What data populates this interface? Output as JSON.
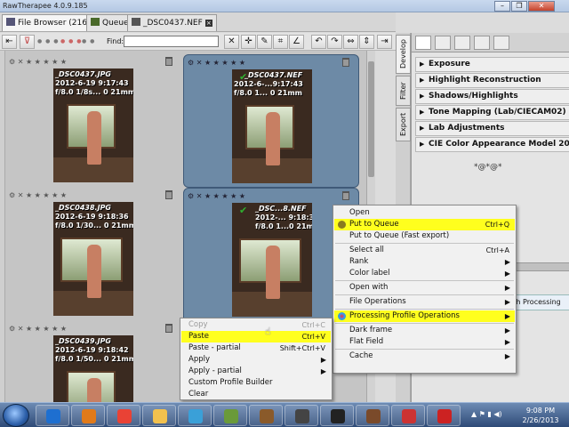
{
  "window": {
    "title": "RawTherapee 4.0.9.185",
    "controls": [
      "–",
      "❐",
      "✕"
    ]
  },
  "tabs": [
    {
      "label": "File Browser (216)",
      "active": true,
      "closable": false
    },
    {
      "label": "Queue",
      "active": false,
      "closable": false
    },
    {
      "label": "_DSC0437.NEF",
      "active": false,
      "closable": true
    }
  ],
  "toolbar": {
    "find_label": "Find:",
    "find_value": ""
  },
  "thumbnails": [
    {
      "filename": "_DSC0437.JPG",
      "date": "2012-6-19 9:17:43",
      "exposure": "f/8.0 1/8s... 0 21mm",
      "selected": false,
      "processed": false
    },
    {
      "filename": "_DSC0437.NEF",
      "date": "2012-6-...9:17:43",
      "exposure": "f/8.0 1... 0 21mm",
      "selected": true,
      "processed": true
    },
    {
      "filename": "_DSC0438.JPG",
      "date": "2012-6-19 9:18:36",
      "exposure": "f/8.0 1/30... 0 21mm",
      "selected": false,
      "processed": false
    },
    {
      "filename": "_DSC...8.NEF",
      "date": "2012-... 9:18:36",
      "exposure": "f/8.0 1...0 21mm",
      "selected": true,
      "processed": true
    },
    {
      "filename": "_DSC0439.JPG",
      "date": "2012-6-19 9:18:42",
      "exposure": "f/8.0 1/50... 0 21mm",
      "selected": false,
      "processed": false
    }
  ],
  "vertical_tabs": [
    "Develop",
    "Filter",
    "Export"
  ],
  "sections": [
    "Exposure",
    "Highlight Reconstruction",
    "Shadows/Highlights",
    "Tone Mapping (Lab/CIECAM02)",
    "Lab Adjustments",
    "CIE Color Appearance Model 2002"
  ],
  "ornament": "*@*@*",
  "batch_button": "ch Processing",
  "context_menu": [
    {
      "label": "Open",
      "accel": "",
      "sub": false,
      "highlight": false,
      "sep_after": false
    },
    {
      "label": "Put to Queue",
      "accel": "Ctrl+Q",
      "sub": false,
      "highlight": true,
      "icon": "gears-icon",
      "sep_after": false
    },
    {
      "label": "Put to Queue (Fast export)",
      "accel": "",
      "sub": false,
      "highlight": false,
      "sep_after": true
    },
    {
      "label": "Select all",
      "accel": "Ctrl+A",
      "sub": false,
      "highlight": false,
      "sep_after": false
    },
    {
      "label": "Rank",
      "accel": "",
      "sub": true,
      "highlight": false,
      "sep_after": false
    },
    {
      "label": "Color label",
      "accel": "",
      "sub": true,
      "highlight": false,
      "sep_after": true
    },
    {
      "label": "Open with",
      "accel": "",
      "sub": true,
      "highlight": false,
      "sep_after": true
    },
    {
      "label": "File Operations",
      "accel": "",
      "sub": true,
      "highlight": false,
      "sep_after": true
    },
    {
      "label": "Processing Profile Operations",
      "accel": "",
      "sub": true,
      "highlight": true,
      "icon": "profile-icon",
      "sep_after": true
    },
    {
      "label": "Dark frame",
      "accel": "",
      "sub": true,
      "highlight": false,
      "sep_after": false
    },
    {
      "label": "Flat Field",
      "accel": "",
      "sub": true,
      "highlight": false,
      "sep_after": true
    },
    {
      "label": "Cache",
      "accel": "",
      "sub": true,
      "highlight": false,
      "sep_after": false
    }
  ],
  "sub_menu": [
    {
      "label": "Copy",
      "accel": "Ctrl+C",
      "disabled": true,
      "highlight": false
    },
    {
      "label": "Paste",
      "accel": "Ctrl+V",
      "disabled": false,
      "highlight": true
    },
    {
      "label": "Paste - partial",
      "accel": "Shift+Ctrl+V",
      "disabled": false,
      "highlight": false
    },
    {
      "label": "Apply",
      "accel": "",
      "sub": true,
      "disabled": false,
      "highlight": false
    },
    {
      "label": "Apply - partial",
      "accel": "",
      "sub": true,
      "disabled": false,
      "highlight": false
    },
    {
      "label": "Custom Profile Builder",
      "accel": "",
      "disabled": false,
      "highlight": false
    },
    {
      "label": "Clear",
      "accel": "",
      "disabled": false,
      "highlight": false
    }
  ],
  "taskbar": {
    "clock_time": "9:08 PM",
    "clock_date": "2/26/2013",
    "apps": [
      "internet-explorer",
      "firefox",
      "chrome",
      "file-explorer",
      "photo-viewer",
      "image-editor",
      "book-app",
      "terminal",
      "game-app",
      "library-app",
      "color-app",
      "rawtherapee-app"
    ]
  }
}
